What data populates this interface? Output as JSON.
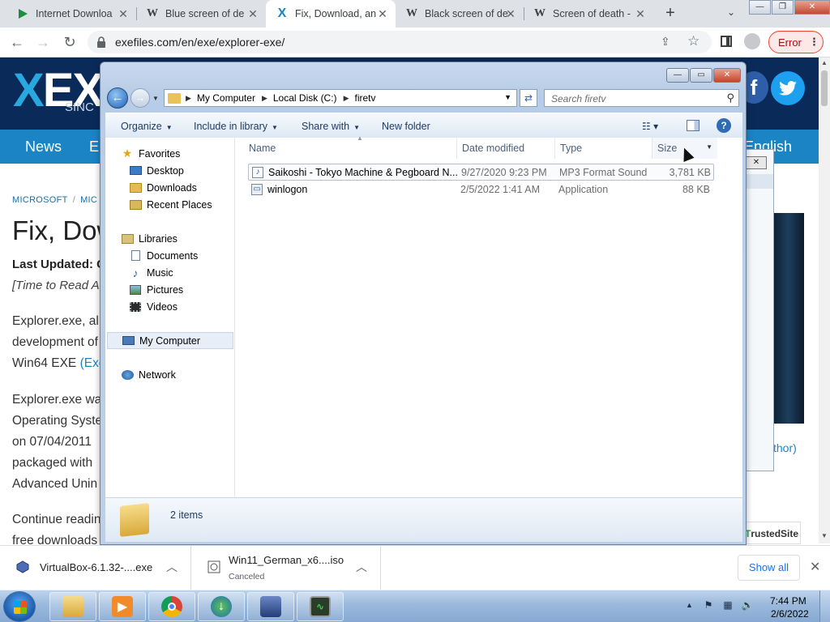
{
  "browser": {
    "tabs": [
      {
        "title": "Internet Downloa",
        "icon": "play-icon"
      },
      {
        "title": "Blue screen of de",
        "icon": "wikipedia-icon"
      },
      {
        "title": "Fix, Download, an",
        "icon": "exefiles-icon"
      },
      {
        "title": "Black screen of de",
        "icon": "wikipedia-icon"
      },
      {
        "title": "Screen of death -",
        "icon": "wikipedia-icon"
      }
    ],
    "url": "exefiles.com/en/exe/explorer-exe/",
    "error_label": "Error"
  },
  "website": {
    "logo_text": "EX",
    "logo_sub": "SINC",
    "nav": {
      "news": "News",
      "second": "E",
      "lang": "English"
    },
    "breadcrumb": [
      "MICROSOFT",
      "MIC"
    ],
    "title": "Fix, Dow",
    "updated": "Last Updated: C",
    "read_time": "[Time to Read A",
    "para1": [
      "Explorer.exe, al",
      "development of",
      "Win64 EXE "
    ],
    "para1_link": "(Exe",
    "para2": [
      "Explorer.exe wa",
      "Operating Syste",
      "on 07/04/2011",
      "packaged with",
      "Advanced Unin"
    ],
    "para3": [
      "Continue readin",
      "free downloads"
    ],
    "side_author": "thor)",
    "trusted_prefix": "T",
    "trusted_label": "rustedSite"
  },
  "explorer": {
    "address": [
      "My Computer",
      "Local Disk (C:)",
      "firetv"
    ],
    "search_placeholder": "Search firetv",
    "commands": {
      "organize": "Organize",
      "include": "Include in library",
      "share": "Share with",
      "new_folder": "New folder"
    },
    "nav": {
      "favorites": "Favorites",
      "desktop": "Desktop",
      "downloads": "Downloads",
      "recent": "Recent Places",
      "libraries": "Libraries",
      "documents": "Documents",
      "music": "Music",
      "pictures": "Pictures",
      "videos": "Videos",
      "computer": "My Computer",
      "network": "Network"
    },
    "columns": {
      "name": "Name",
      "date": "Date modified",
      "type": "Type",
      "size": "Size"
    },
    "files": [
      {
        "name": "Saikoshi - Tokyo Machine & Pegboard N...",
        "date": "9/27/2020 9:23 PM",
        "type": "MP3 Format Sound",
        "size": "3,781 KB"
      },
      {
        "name": "winlogon",
        "date": "2/5/2022 1:41 AM",
        "type": "Application",
        "size": "88 KB"
      }
    ],
    "item_count": "2 items"
  },
  "downloads": [
    {
      "name": "VirtualBox-6.1.32-....exe",
      "status": ""
    },
    {
      "name": "Win11_German_x6....iso",
      "status": "Canceled"
    }
  ],
  "show_all": "Show all",
  "taskbar": {
    "apps": [
      "explorer",
      "media-player",
      "chrome",
      "idm",
      "virtualbox",
      "task-manager"
    ],
    "time": "7:44 PM",
    "date": "2/6/2022"
  }
}
